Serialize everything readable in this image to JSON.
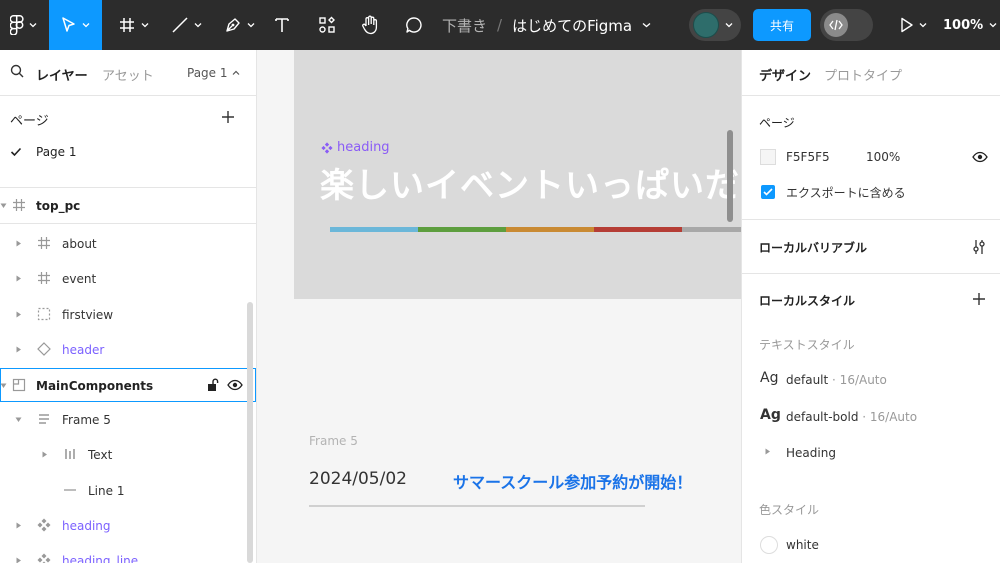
{
  "toolbar": {
    "draft": "下書き",
    "separator": "/",
    "file_name": "はじめてのFigma",
    "share": "共有",
    "zoom": "100%"
  },
  "left_panel": {
    "tabs": {
      "layers": "レイヤー",
      "assets": "アセット",
      "page_selector": "Page 1"
    },
    "pages_header": "ページ",
    "pages": [
      {
        "label": "Page 1",
        "selected": true
      }
    ],
    "frame": "top_pc",
    "layers": [
      {
        "label": "about",
        "icon": "frame-icon"
      },
      {
        "label": "event",
        "icon": "frame-icon"
      },
      {
        "label": "firstview",
        "icon": "section-icon"
      },
      {
        "label": "header",
        "icon": "component-instance-icon"
      },
      {
        "label": "MainComponents",
        "icon": "section-box-icon",
        "selected": true
      },
      {
        "label": "Frame 5",
        "icon": "vertical-layout-icon"
      },
      {
        "label": "Text",
        "icon": "horizontal-layout-icon"
      },
      {
        "label": "Line 1",
        "icon": "line-icon"
      },
      {
        "label": "heading",
        "icon": "component-icon"
      },
      {
        "label": "heading_line",
        "icon": "component-icon"
      }
    ]
  },
  "canvas": {
    "heading_tag": "heading",
    "big_title": "楽しいイベントいっぱいだ",
    "bar_colors": [
      "#6bb7d9",
      "#5d9e3e",
      "#c98a33",
      "#b53d35",
      "#a8a8a8"
    ],
    "frame5_label": "Frame 5",
    "news_date": "2024/05/02",
    "news_title": "サマースクール参加予約が開始！"
  },
  "right_panel": {
    "tabs": {
      "design": "デザイン",
      "prototype": "プロトタイプ"
    },
    "page_section": "ページ",
    "page_color": "F5F5F5",
    "page_opacity": "100%",
    "export_label": "エクスポートに含める",
    "local_variables": "ローカルバリアブル",
    "local_styles": "ローカルスタイル",
    "text_styles_header": "テキストスタイル",
    "text_styles": [
      {
        "sample": "Ag",
        "name": "default",
        "meta": " · 16/Auto"
      },
      {
        "sample": "Ag",
        "name": "default-bold",
        "meta": " · 16/Auto"
      }
    ],
    "heading_group": "Heading",
    "color_styles_header": "色スタイル",
    "color_styles": [
      {
        "name": "white",
        "color": "#ffffff"
      }
    ]
  },
  "colors": {
    "accent": "#0d99ff",
    "toolbar_bg": "#2c2c2c",
    "component_purple": "#7b61ff",
    "link_blue": "#1a73e8"
  }
}
